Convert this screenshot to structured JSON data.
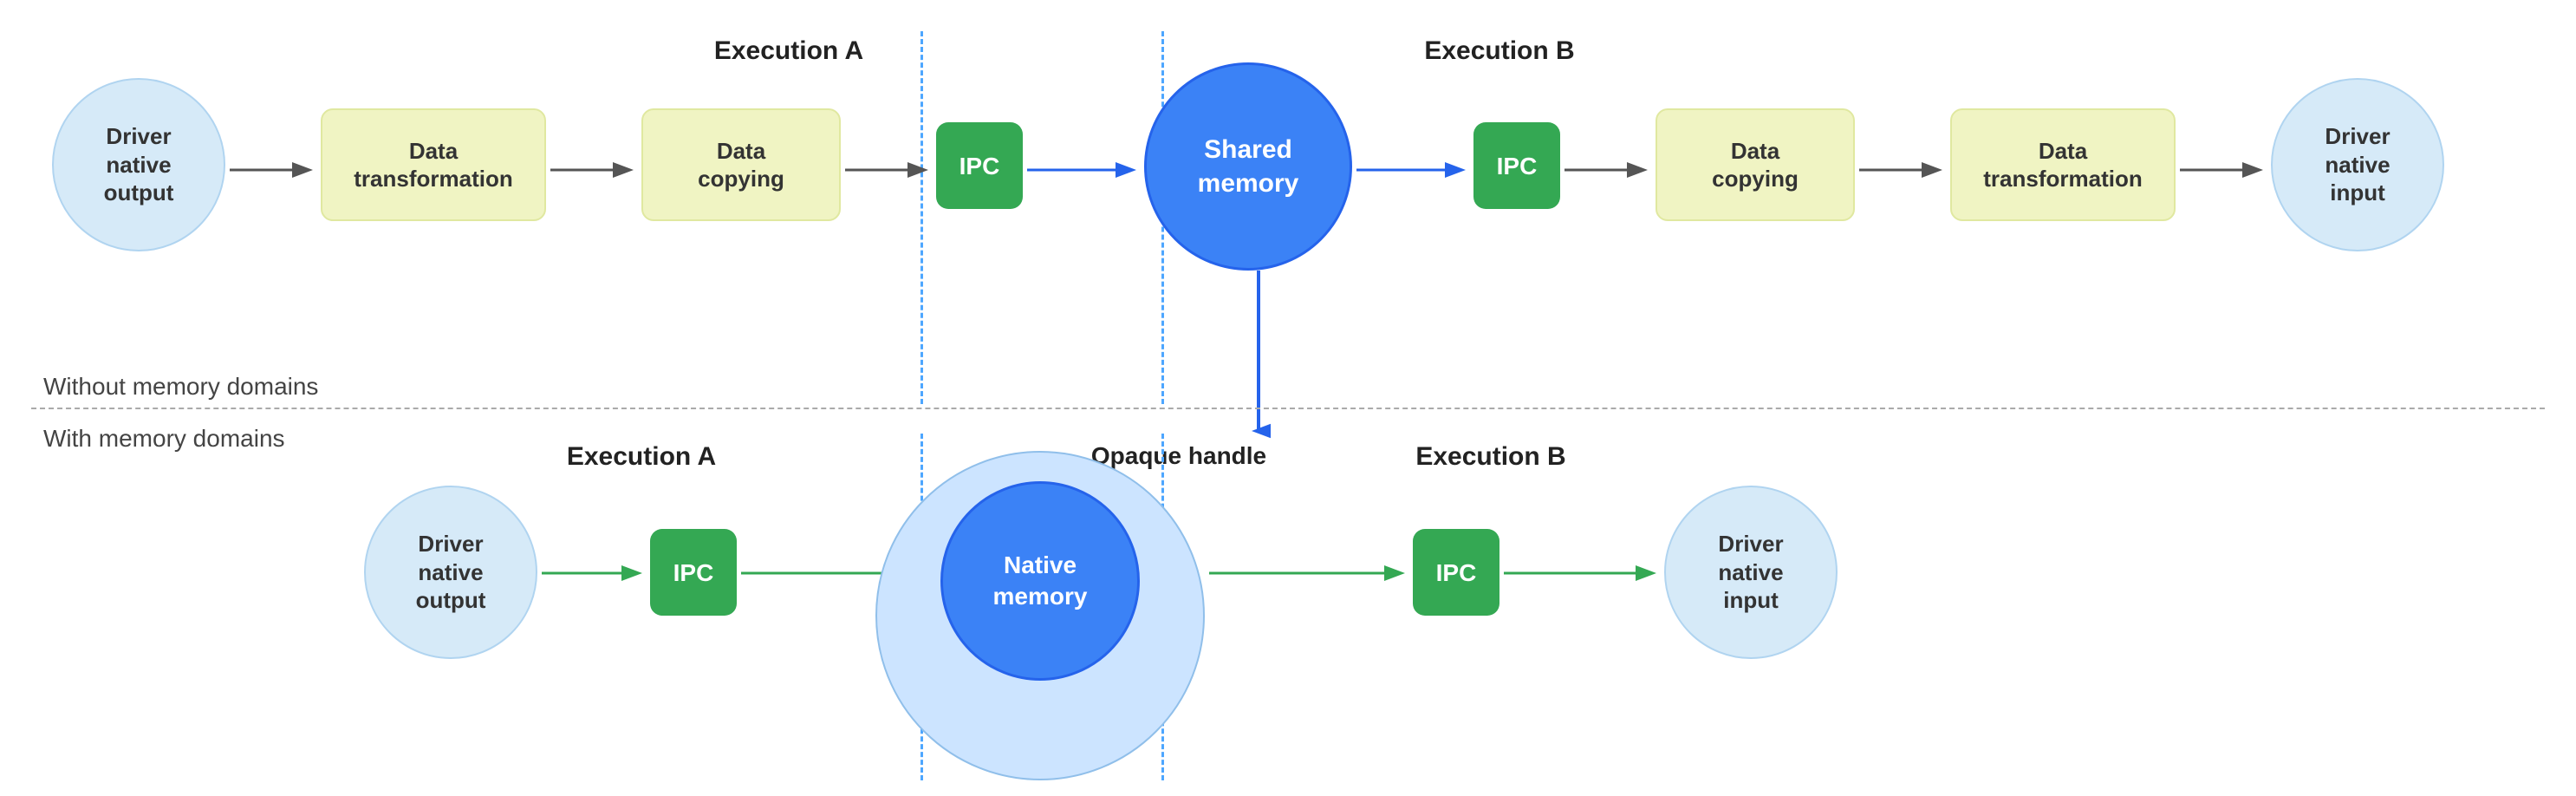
{
  "top_section_label": "Without memory domains",
  "bottom_section_label": "With memory domains",
  "top_exec_a_label": "Execution A",
  "top_exec_b_label": "Execution B",
  "bottom_exec_a_label": "Execution A",
  "bottom_exec_b_label": "Execution B",
  "opaque_handle_label": "Opaque handle",
  "top_row": {
    "nodes": [
      {
        "id": "top-driver-out",
        "text": "Driver\nnative\noutput",
        "type": "circle-light"
      },
      {
        "id": "top-data-transform-a",
        "text": "Data\ntransformation",
        "type": "rect-yellow"
      },
      {
        "id": "top-data-copy-a",
        "text": "Data\ncopying",
        "type": "rect-yellow"
      },
      {
        "id": "top-ipc-a",
        "text": "IPC",
        "type": "rect-green"
      },
      {
        "id": "top-shared-mem",
        "text": "Shared\nmemory",
        "type": "circle-blue"
      },
      {
        "id": "top-ipc-b",
        "text": "IPC",
        "type": "rect-green"
      },
      {
        "id": "top-data-copy-b",
        "text": "Data\ncopying",
        "type": "rect-yellow"
      },
      {
        "id": "top-data-transform-b",
        "text": "Data\ntransformation",
        "type": "rect-yellow"
      },
      {
        "id": "top-driver-in",
        "text": "Driver\nnative\ninput",
        "type": "circle-light"
      }
    ]
  },
  "bottom_row": {
    "nodes": [
      {
        "id": "bot-driver-out",
        "text": "Driver\nnative\noutput",
        "type": "circle-light"
      },
      {
        "id": "bot-ipc-a",
        "text": "IPC",
        "type": "rect-green"
      },
      {
        "id": "bot-native-mem",
        "text": "Native\nmemory",
        "type": "circle-blue-large"
      },
      {
        "id": "bot-ipc-b",
        "text": "IPC",
        "type": "rect-green"
      },
      {
        "id": "bot-driver-in",
        "text": "Driver\nnative\ninput",
        "type": "circle-light"
      }
    ]
  }
}
